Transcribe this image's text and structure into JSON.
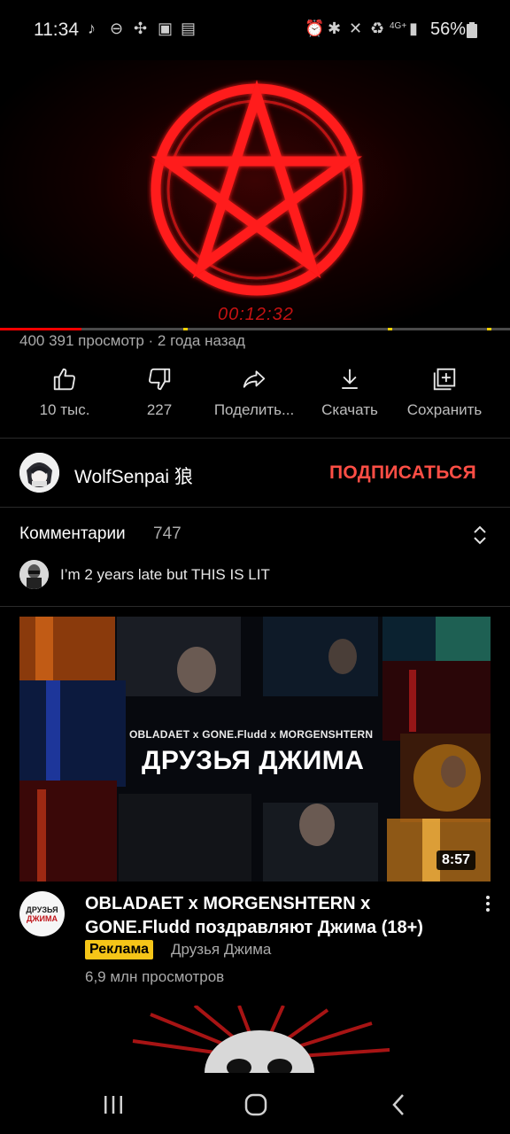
{
  "status_bar": {
    "time": "11:34",
    "battery_percent": "56%",
    "left_icons": [
      "music-note-icon",
      "do-not-disturb-icon",
      "fan-icon",
      "gallery-icon",
      "news-icon"
    ],
    "right_icons": [
      "alarm-icon",
      "bluetooth-icon",
      "mute-icon",
      "battery-saver-icon",
      "4g-icon",
      "signal-icon",
      "battery-icon"
    ]
  },
  "video": {
    "timecode_overlay": "00:12:32",
    "progress_fraction": 0.16,
    "ad_marker_fractions": [
      0.36,
      0.76,
      0.955
    ]
  },
  "meta": {
    "views_line": "400 391 просмотр · 2 года назад"
  },
  "actions": [
    {
      "icon": "thumbs-up-icon",
      "label": "10 тыс."
    },
    {
      "icon": "thumbs-down-icon",
      "label": "227"
    },
    {
      "icon": "share-icon",
      "label": "Поделить..."
    },
    {
      "icon": "download-icon",
      "label": "Скачать"
    },
    {
      "icon": "save-playlist-icon",
      "label": "Сохранить"
    }
  ],
  "channel": {
    "name": "WolfSenpai 狼",
    "subscribe_label": "ПОДПИСАТЬСЯ"
  },
  "comments": {
    "title": "Комментарии",
    "count": "747",
    "top_comment": "I’m 2 years late but THIS IS LIT"
  },
  "ad": {
    "thumbnail_overlay_small": "OBLADAET x GONE.Fludd x MORGENSHTERN",
    "thumbnail_overlay_big": "ДРУЗЬЯ ДЖИМА",
    "duration": "8:57",
    "logo_text_line1": "ДРУЗЬЯ",
    "logo_text_line2": "ДЖИМА",
    "title": "OBLADAET x MORGENSHTERN x GONE.Fludd поздравляют Джима (18+)",
    "badge": "Реклама",
    "channel": "Друзья Джима",
    "views": "6,9 млн просмотров"
  },
  "colors": {
    "accent_red": "#ff4e45",
    "progress_red": "#ff0000",
    "ad_badge_yellow": "#f5c518"
  }
}
